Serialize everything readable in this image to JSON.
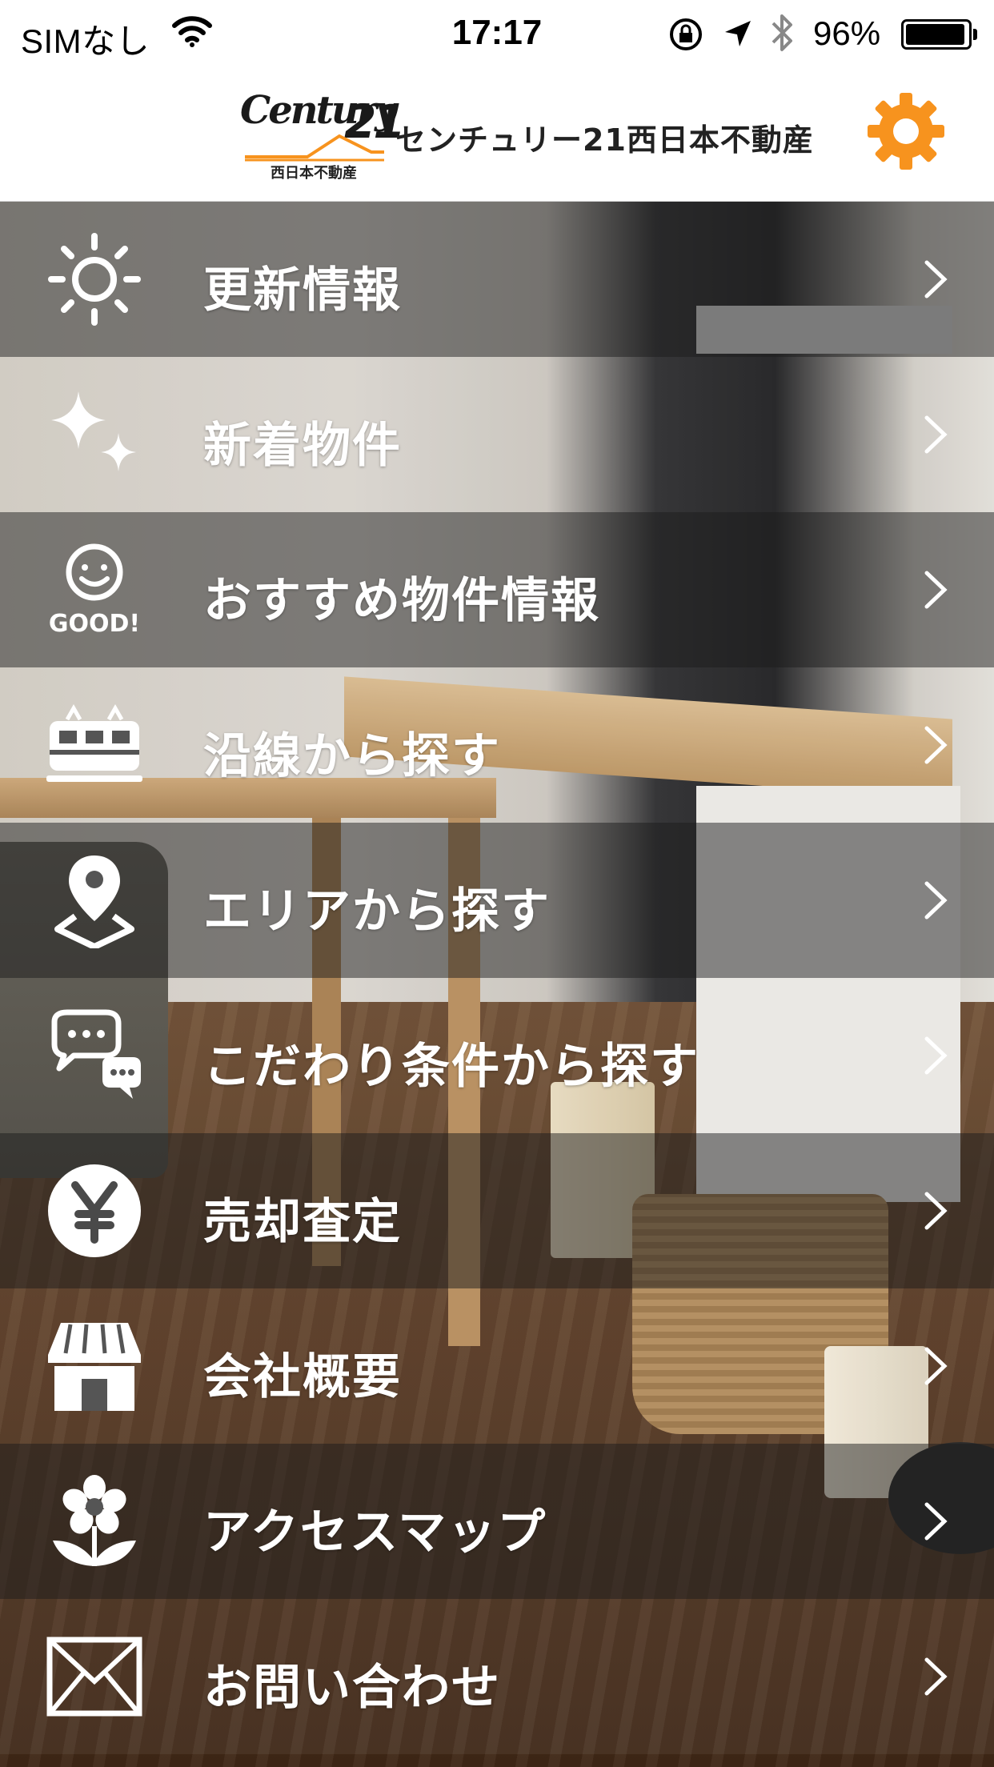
{
  "status_bar": {
    "carrier": "SIMなし",
    "time": "17:17",
    "battery_percent": "96%"
  },
  "header": {
    "logo_brand": "Century",
    "logo_number": "21",
    "logo_subtitle": "西日本不動産",
    "company_name": "センチュリー21西日本不動産",
    "settings_icon": "gear-icon",
    "accent_color": "#F7931E"
  },
  "menu": {
    "items": [
      {
        "label": "更新情報",
        "icon": "sun-icon"
      },
      {
        "label": "新着物件",
        "icon": "sparkle-icon"
      },
      {
        "label": "おすすめ物件情報",
        "icon": "good-smiley-icon",
        "icon_text": "GOOD!"
      },
      {
        "label": "沿線から探す",
        "icon": "train-icon"
      },
      {
        "label": "エリアから探す",
        "icon": "map-pin-icon"
      },
      {
        "label": "こだわり条件から探す",
        "icon": "chat-bubbles-icon"
      },
      {
        "label": "売却査定",
        "icon": "yen-icon"
      },
      {
        "label": "会社概要",
        "icon": "store-icon"
      },
      {
        "label": "アクセスマップ",
        "icon": "flower-icon"
      },
      {
        "label": "お問い合わせ",
        "icon": "mail-icon"
      }
    ]
  }
}
